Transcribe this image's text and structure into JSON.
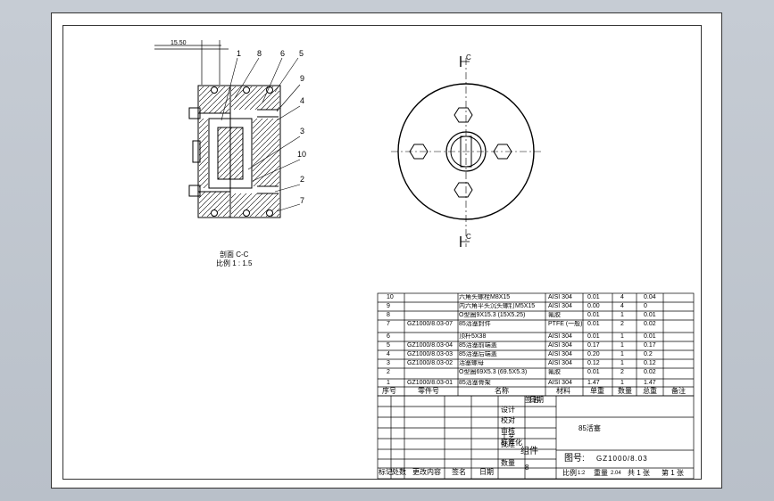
{
  "drawing": {
    "dimension_label": "15.50",
    "balloons": [
      "1",
      "8",
      "6",
      "5",
      "9",
      "4",
      "3",
      "10",
      "2",
      "7"
    ],
    "section_marker": "C",
    "section_title": "剖面 C-C",
    "section_scale": "比例 1 : 1.5"
  },
  "bom": {
    "rows": [
      {
        "no": "10",
        "code": "",
        "name": "六角头螺栓M8X15",
        "material": "AISI 304",
        "unit_weight": "0.01",
        "qty": "4",
        "total": "0.04"
      },
      {
        "no": "9",
        "code": "",
        "name": "内六角平头沉头螺钉M5X15",
        "material": "AISI 304",
        "unit_weight": "0.00",
        "qty": "4",
        "total": "0"
      },
      {
        "no": "8",
        "code": "",
        "name": "O型圈9X15.3 (15X5.25)",
        "material": "氟胶",
        "unit_weight": "0.01",
        "qty": "1",
        "total": "0.01"
      },
      {
        "no": "7",
        "code": "GZ1000/8.03-07",
        "name": "85活塞封件",
        "material": "PTFE (一般)",
        "unit_weight": "0.01",
        "qty": "2",
        "total": "0.02"
      },
      {
        "no": "6",
        "code": "",
        "name": "顶杆5X38",
        "material": "AISI 304",
        "unit_weight": "0.01",
        "qty": "1",
        "total": "0.01"
      },
      {
        "no": "5",
        "code": "GZ1000/8.03-04",
        "name": "85活塞前端盖",
        "material": "AISI 304",
        "unit_weight": "0.17",
        "qty": "1",
        "total": "0.17"
      },
      {
        "no": "4",
        "code": "GZ1000/8.03-03",
        "name": "85活塞后端盖",
        "material": "AISI 304",
        "unit_weight": "0.20",
        "qty": "1",
        "total": "0.2"
      },
      {
        "no": "3",
        "code": "GZ1000/8.03-02",
        "name": "活塞螺母",
        "material": "AISI 304",
        "unit_weight": "0.12",
        "qty": "1",
        "total": "0.12"
      },
      {
        "no": "2",
        "code": "",
        "name": "O型圈69X5.3 (69.5X5.3)",
        "material": "氟胶",
        "unit_weight": "0.01",
        "qty": "2",
        "total": "0.02"
      },
      {
        "no": "1",
        "code": "GZ1000/8.03-01",
        "name": "85活塞骨架",
        "material": "AISI 304",
        "unit_weight": "1.47",
        "qty": "1",
        "total": "1.47"
      }
    ],
    "headers": [
      "序号",
      "零件号",
      "名称",
      "材料",
      "单重",
      "数量",
      "总重",
      "备注"
    ]
  },
  "title_block": {
    "role_labels": [
      "设计",
      "校对",
      "审核",
      "工艺",
      "标准化",
      "批准"
    ],
    "sign_label": "签名",
    "date_label": "日期",
    "revision_labels": [
      "标记",
      "处数",
      "更改内容",
      "签名",
      "日期"
    ],
    "assembly_label": "组件",
    "quantity_label": "数量",
    "quantity_value": "8",
    "part_name": "85活塞",
    "drawing_no_label": "图号:",
    "drawing_no": "GZ1000/8.03",
    "scale_label": "比例",
    "scale_value": "1:2",
    "weight_label": "重量",
    "weight_value": "2.04",
    "sheets_total_label": "共 1 张",
    "sheet_label": "第 1 张"
  }
}
